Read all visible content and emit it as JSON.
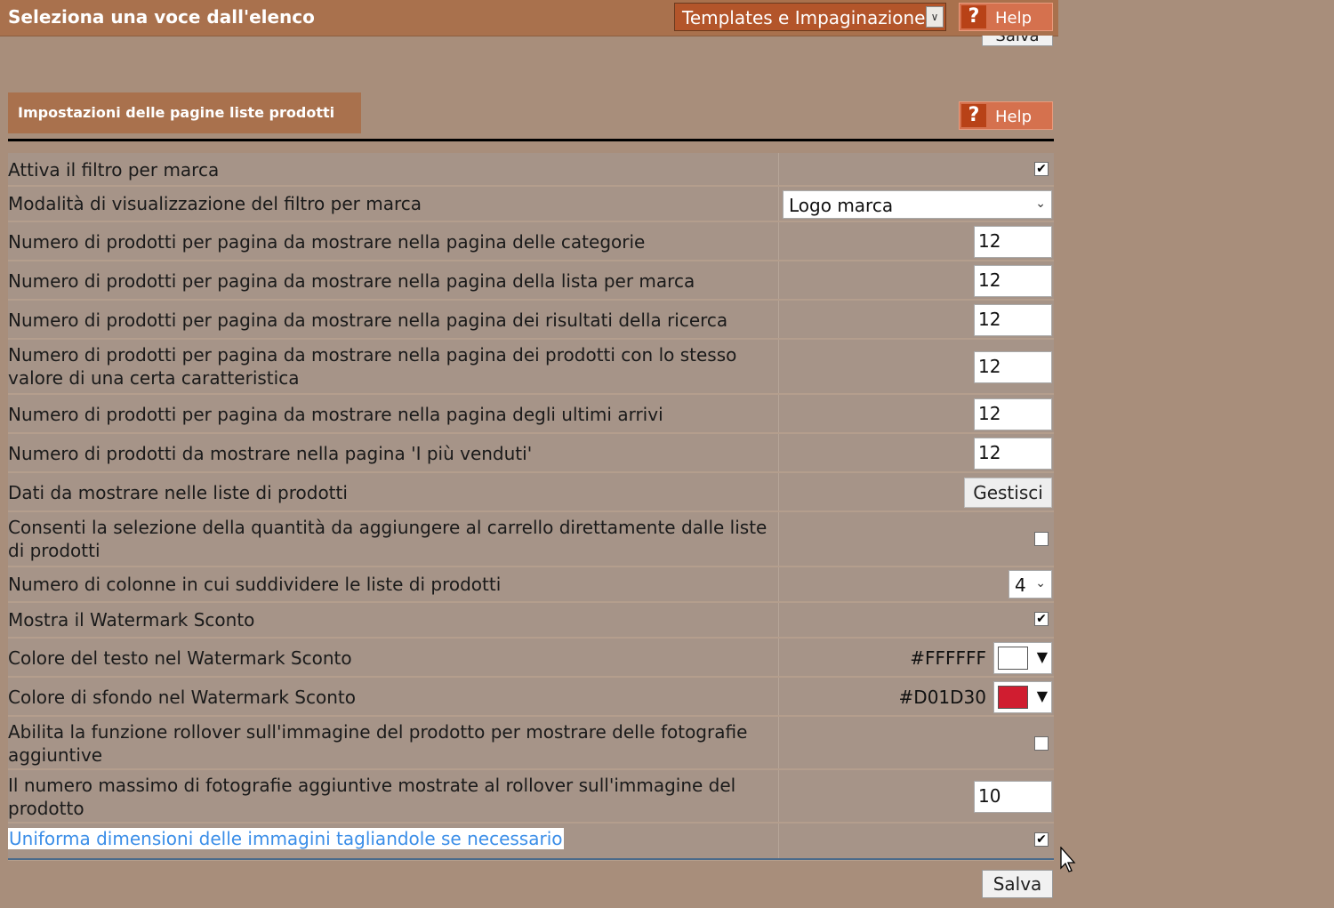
{
  "header": {
    "title": "Seleziona una voce dall'elenco",
    "select_value": "Templates e Impaginazione",
    "help_label": "Help",
    "top_save_label": "Salva"
  },
  "section": {
    "title": "Impostazioni delle pagine liste prodotti",
    "help_label": "Help"
  },
  "rows": [
    {
      "label": "Attiva il filtro per marca",
      "type": "checkbox",
      "checked": true
    },
    {
      "label": "Modalità di visualizzazione del filtro per marca",
      "type": "select",
      "value": "Logo marca"
    },
    {
      "label": "Numero di prodotti per pagina da mostrare nella pagina delle categorie",
      "type": "number",
      "value": "12"
    },
    {
      "label": "Numero di prodotti per pagina da mostrare nella pagina della lista per marca",
      "type": "number",
      "value": "12"
    },
    {
      "label": "Numero di prodotti per pagina da mostrare nella pagina dei risultati della ricerca",
      "type": "number",
      "value": "12"
    },
    {
      "label": "Numero di prodotti per pagina da mostrare nella pagina dei prodotti con lo stesso valore di una certa caratteristica",
      "type": "number",
      "value": "12"
    },
    {
      "label": "Numero di prodotti per pagina da mostrare nella pagina degli ultimi arrivi",
      "type": "number",
      "value": "12"
    },
    {
      "label": "Numero di prodotti da mostrare nella pagina 'I più venduti'",
      "type": "number",
      "value": "12"
    },
    {
      "label": "Dati da mostrare nelle liste di prodotti",
      "type": "button",
      "value": "Gestisci"
    },
    {
      "label": "Consenti la selezione della quantità da aggiungere al carrello direttamente dalle liste di prodotti",
      "type": "checkbox",
      "checked": false
    },
    {
      "label": "Numero di colonne in cui suddividere le liste di prodotti",
      "type": "small-select",
      "value": "4"
    },
    {
      "label": "Mostra il Watermark Sconto",
      "type": "checkbox",
      "checked": true
    },
    {
      "label": "Colore del testo nel Watermark Sconto",
      "type": "color",
      "value": "#FFFFFF",
      "swatch": "#FFFFFF"
    },
    {
      "label": "Colore di sfondo nel Watermark Sconto",
      "type": "color",
      "value": "#D01D30",
      "swatch": "#D01D30"
    },
    {
      "label": "Abilita la funzione rollover sull'immagine del prodotto per mostrare delle fotografie aggiuntive",
      "type": "checkbox",
      "checked": false
    },
    {
      "label": "Il numero massimo di fotografie aggiuntive mostrate al rollover sull'immagine del prodotto",
      "type": "number",
      "value": "10"
    },
    {
      "label": "Uniforma dimensioni delle immagini tagliandole se necessario",
      "type": "checkbox",
      "checked": true,
      "highlight": true
    }
  ],
  "footer": {
    "save_label": "Salva"
  },
  "colors": {
    "header_bg": "#a9714d",
    "page_bg": "#a88e7b",
    "row_bg": "#a69488",
    "link": "#3b8ee8"
  }
}
